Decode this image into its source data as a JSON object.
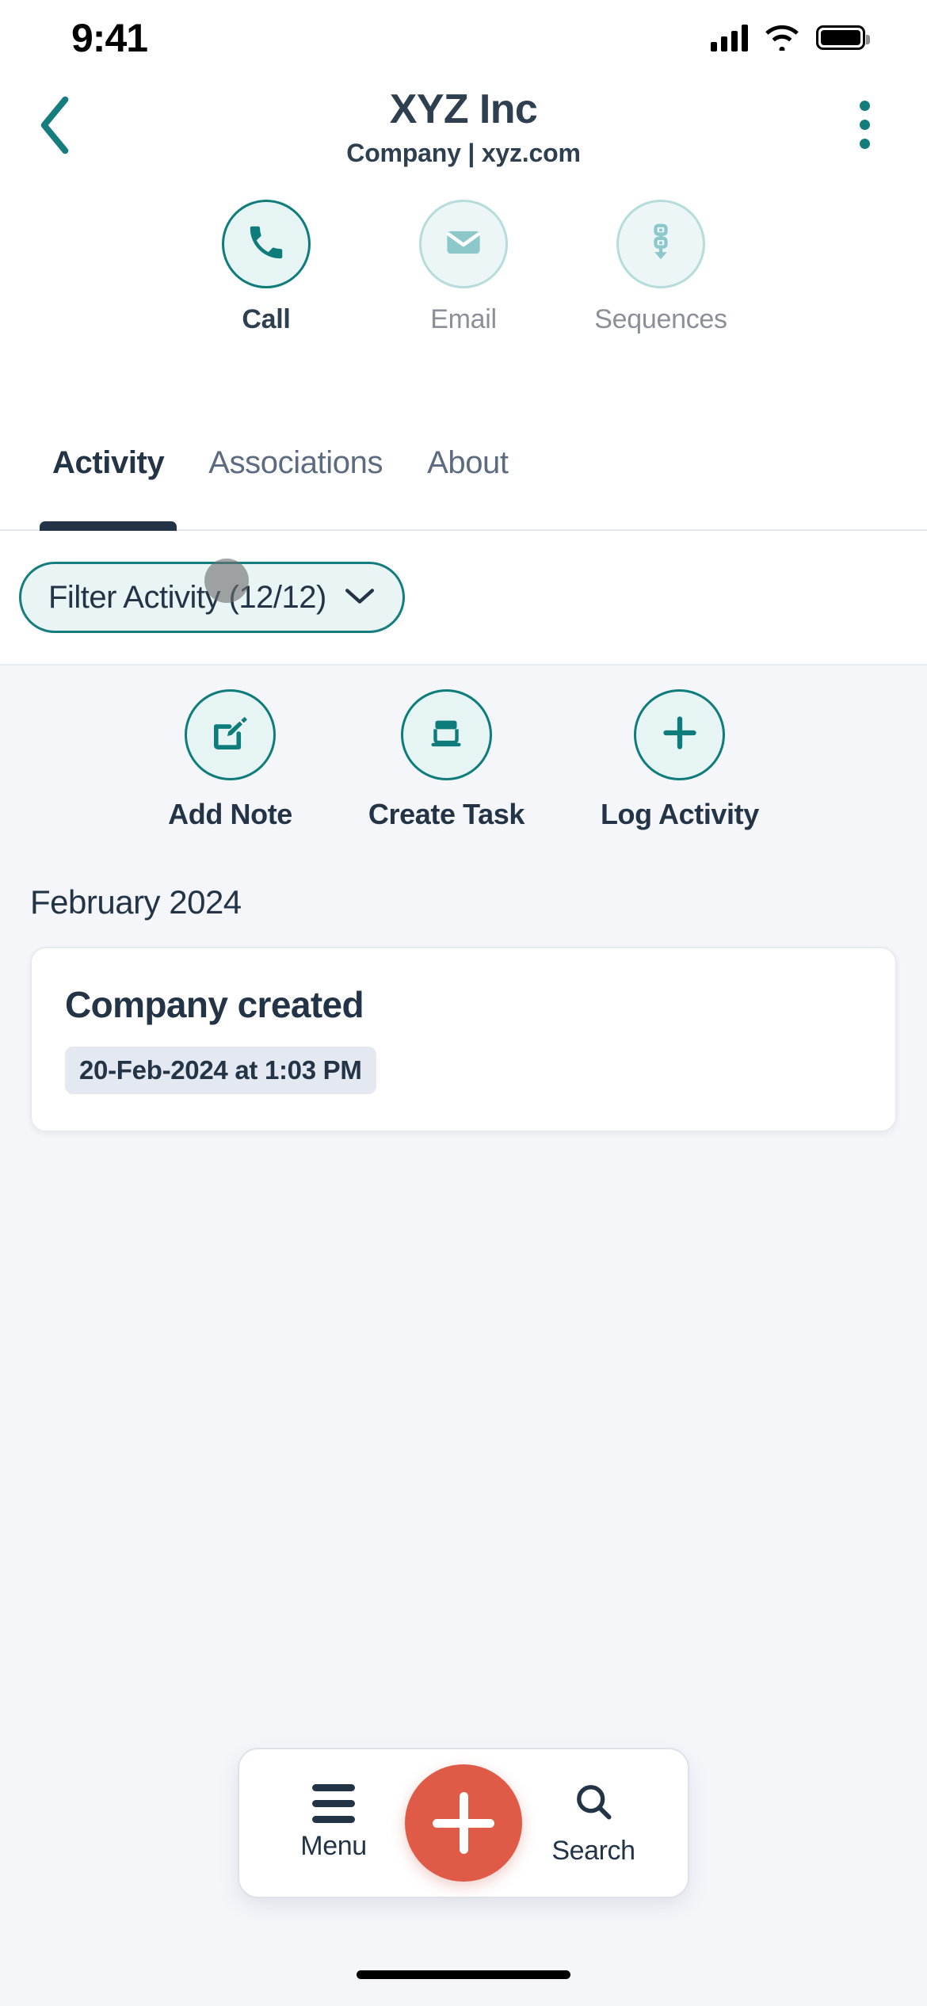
{
  "status_bar": {
    "time": "9:41",
    "signal_icon": "cellular-signal-icon",
    "wifi_icon": "wifi-icon",
    "battery_icon": "battery-icon"
  },
  "header": {
    "back_icon": "back-chevron-icon",
    "title": "XYZ Inc",
    "subtitle": "Company | xyz.com",
    "overflow_icon": "kebab-menu-icon",
    "accent_color": "#167D7F",
    "quick_actions": [
      {
        "label": "Call",
        "icon": "phone-icon",
        "enabled": true
      },
      {
        "label": "Email",
        "icon": "envelope-icon",
        "enabled": false
      },
      {
        "label": "Sequences",
        "icon": "sequences-icon",
        "enabled": false
      }
    ]
  },
  "tabs": {
    "items": [
      {
        "label": "Activity",
        "active": true
      },
      {
        "label": "Associations",
        "active": false
      },
      {
        "label": "About",
        "active": false
      }
    ]
  },
  "filter": {
    "label": "Filter Activity (12/12)",
    "chevron_icon": "chevron-down-icon",
    "count_shown": 12,
    "count_total": 12
  },
  "activity_actions": [
    {
      "label": "Add Note",
      "icon": "edit-note-icon"
    },
    {
      "label": "Create Task",
      "icon": "task-laptop-icon"
    },
    {
      "label": "Log Activity",
      "icon": "plus-icon"
    }
  ],
  "timeline": {
    "month_header": "February 2024",
    "entries": [
      {
        "title": "Company created",
        "timestamp": "20-Feb-2024 at 1:03 PM"
      }
    ]
  },
  "bottom_nav": {
    "menu_label": "Menu",
    "menu_icon": "hamburger-icon",
    "fab_icon": "plus-icon",
    "fab_color": "#E05B47",
    "search_label": "Search",
    "search_icon": "search-icon"
  }
}
